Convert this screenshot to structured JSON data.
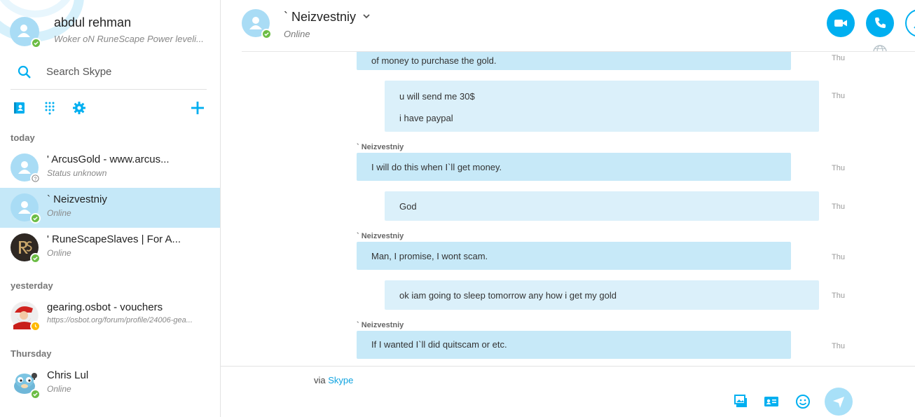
{
  "profile": {
    "name": "abdul rehman",
    "mood": "Woker oN RuneScape Power leveli..."
  },
  "search": {
    "placeholder": "Search Skype"
  },
  "sections": {
    "today": "today",
    "yesterday": "yesterday",
    "thursday": "Thursday"
  },
  "contacts": [
    {
      "name": "' ArcusGold - www.arcus...",
      "sub": "Status unknown",
      "status": "unknown"
    },
    {
      "name": "` Neizvestniy",
      "sub": "Online",
      "status": "online",
      "selected": true
    },
    {
      "name": "' RuneScapeSlaves | For A...",
      "sub": "Online",
      "status": "online"
    },
    {
      "name": "gearing.osbot - vouchers",
      "sub": "https://osbot.org/forum/profile/24006-gea...",
      "status": "away"
    },
    {
      "name": "Chris Lul",
      "sub": "Online",
      "status": "online"
    }
  ],
  "conversation": {
    "name": "` Neizvestniy",
    "status": "Online"
  },
  "messages": [
    {
      "from": "them",
      "lines": [
        "of money to purchase the gold."
      ],
      "time": "Thu"
    },
    {
      "from": "me",
      "lines": [
        "u will send me 30$",
        "i have paypal"
      ],
      "time": "Thu"
    },
    {
      "from": "them",
      "sender": "` Neizvestniy",
      "lines": [
        "I will do this when I`ll get money."
      ],
      "time": "Thu"
    },
    {
      "from": "me",
      "lines": [
        "God"
      ],
      "time": "Thu"
    },
    {
      "from": "them",
      "sender": "` Neizvestniy",
      "lines": [
        "Man, I promise, I wont scam."
      ],
      "time": "Thu"
    },
    {
      "from": "me",
      "lines": [
        "ok iam going to sleep tomorrow any how i get my gold"
      ],
      "time": "Thu"
    },
    {
      "from": "them",
      "sender": "` Neizvestniy",
      "lines": [
        "If I wanted I`ll did quitscam or etc."
      ],
      "time": "Thu"
    }
  ],
  "composer": {
    "via_prefix": "via",
    "via_link": "Skype"
  },
  "icons": {
    "search": "search-icon",
    "contacts": "address-book-icon",
    "dialpad": "dialpad-icon",
    "settings": "gear-icon",
    "add": "plus-icon",
    "video_call": "video-call-icon",
    "audio_call": "phone-icon",
    "add_people": "add-person-icon",
    "globe": "globe-icon",
    "send_image": "image-icon",
    "send_contact": "contact-card-icon",
    "emoticon": "smiley-icon",
    "send": "send-icon"
  },
  "colors": {
    "accent": "#00aff0",
    "online": "#6cbd45",
    "away": "#ffb900",
    "bubble_them": "#c7e9f8",
    "bubble_me": "#dbf0fa",
    "selected_row": "#c5e8f8"
  }
}
